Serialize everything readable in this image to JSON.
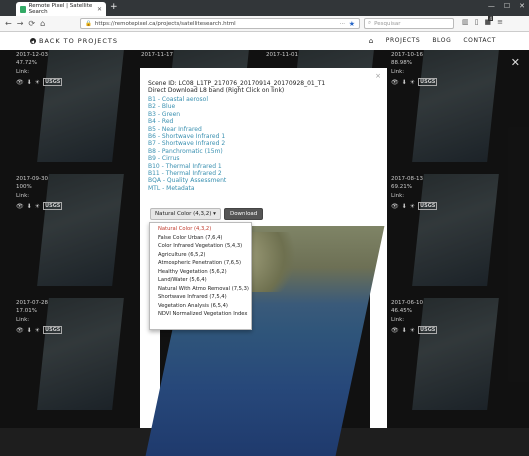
{
  "browser": {
    "tab_title": "Remote Pixel | Satellite Search",
    "url": "https://remotepixel.ca/projects/satellitesearch.html",
    "search_placeholder": "Pesquisar",
    "badge_count": "4"
  },
  "site_header": {
    "back_label": "BACK TO PROJECTS",
    "menu": [
      "PROJECTS",
      "BLOG",
      "CONTACT"
    ]
  },
  "cards": [
    {
      "date": "2017-12-03",
      "cloud": "47.72%",
      "link": "Link:"
    },
    {
      "date": "2017-11-17",
      "cloud": "",
      "link": ""
    },
    {
      "date": "2017-11-01",
      "cloud": "",
      "link": ""
    },
    {
      "date": "2017-10-16",
      "cloud": "88.98%",
      "link": "Link:"
    },
    {
      "date": "2017-09-30",
      "cloud": "100%",
      "link": "Link:"
    },
    {
      "date": "2017-08-13",
      "cloud": "69.21%",
      "link": "Link:"
    },
    {
      "date": "2017-07-28",
      "cloud": "17.01%",
      "link": "Link:"
    },
    {
      "date": "2017-06-10",
      "cloud": "46.45%",
      "link": "Link:"
    }
  ],
  "modal": {
    "scene_id": "Scene ID: LC08_L1TP_217076_20170914_20170928_01_T1",
    "direct_download": "Direct Download L8 band (Right Click on link)",
    "bands": [
      "B1 - Coastal aerosol",
      "B2 - Blue",
      "B3 - Green",
      "B4 - Red",
      "B5 - Near Infrared",
      "B6 - Shortwave Infrared 1",
      "B7 - Shortwave Infrared 2",
      "B8 - Panchromatic (15m)",
      "B9 - Cirrus",
      "B10 - Thermal Infrared 1",
      "B11 - Thermal Infrared 2",
      "BQA - Quality Assessment",
      "MTL - Metadata"
    ],
    "combo_button": "Natural Color (4,3,2) ▾",
    "download_button": "Download",
    "combo_options": [
      "Natural Color (4,3,2)",
      "False Color Urban (7,6,4)",
      "Color Infrared Vegetation (5,4,3)",
      "Agriculture (6,5,2)",
      "Atmospheric Penetration (7,6,5)",
      "Healthy Vegetation (5,6,2)",
      "Land/Water (5,6,4)",
      "Natural With Atmo Removal (7,5,3)",
      "Shortwave Infrared (7,5,4)",
      "Vegetation Analysis (6,5,4)",
      "NDVI Normalized Vegetation Index"
    ]
  }
}
